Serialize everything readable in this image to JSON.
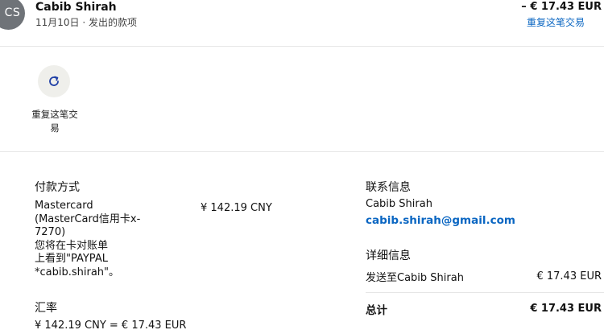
{
  "header": {
    "avatar_initials": "CS",
    "merchant_name": "Cabib Shirah",
    "meta": "11月10日 · 发出的款项",
    "amount": "– € 17.43 EUR",
    "repeat_link": "重复这笔交易"
  },
  "actions": {
    "repeat_label": "重复这笔交易",
    "repeat_icon": "refresh-icon"
  },
  "payment": {
    "title": "付款方式",
    "description": "Mastercard\n(MasterCard信用卡x-\n7270)\n您将在卡对账单\n上看到\"PAYPAL\n*cabib.shirah\"。",
    "amount": "¥ 142.19 CNY"
  },
  "exchange": {
    "title": "汇率",
    "value": "¥ 142.19 CNY = € 17.43 EUR"
  },
  "contact": {
    "title": "联系信息",
    "name": "Cabib Shirah",
    "email": "cabib.shirah@gmail.com"
  },
  "details": {
    "title": "详细信息",
    "sent_to": "发送至Cabib Shirah",
    "sent_amount": "€ 17.43 EUR",
    "total_label": "总计",
    "total_amount": "€ 17.43 EUR"
  },
  "colors": {
    "link": "#0a66c2",
    "avatar_bg": "#6f7378",
    "action_bg": "#efefeb"
  }
}
